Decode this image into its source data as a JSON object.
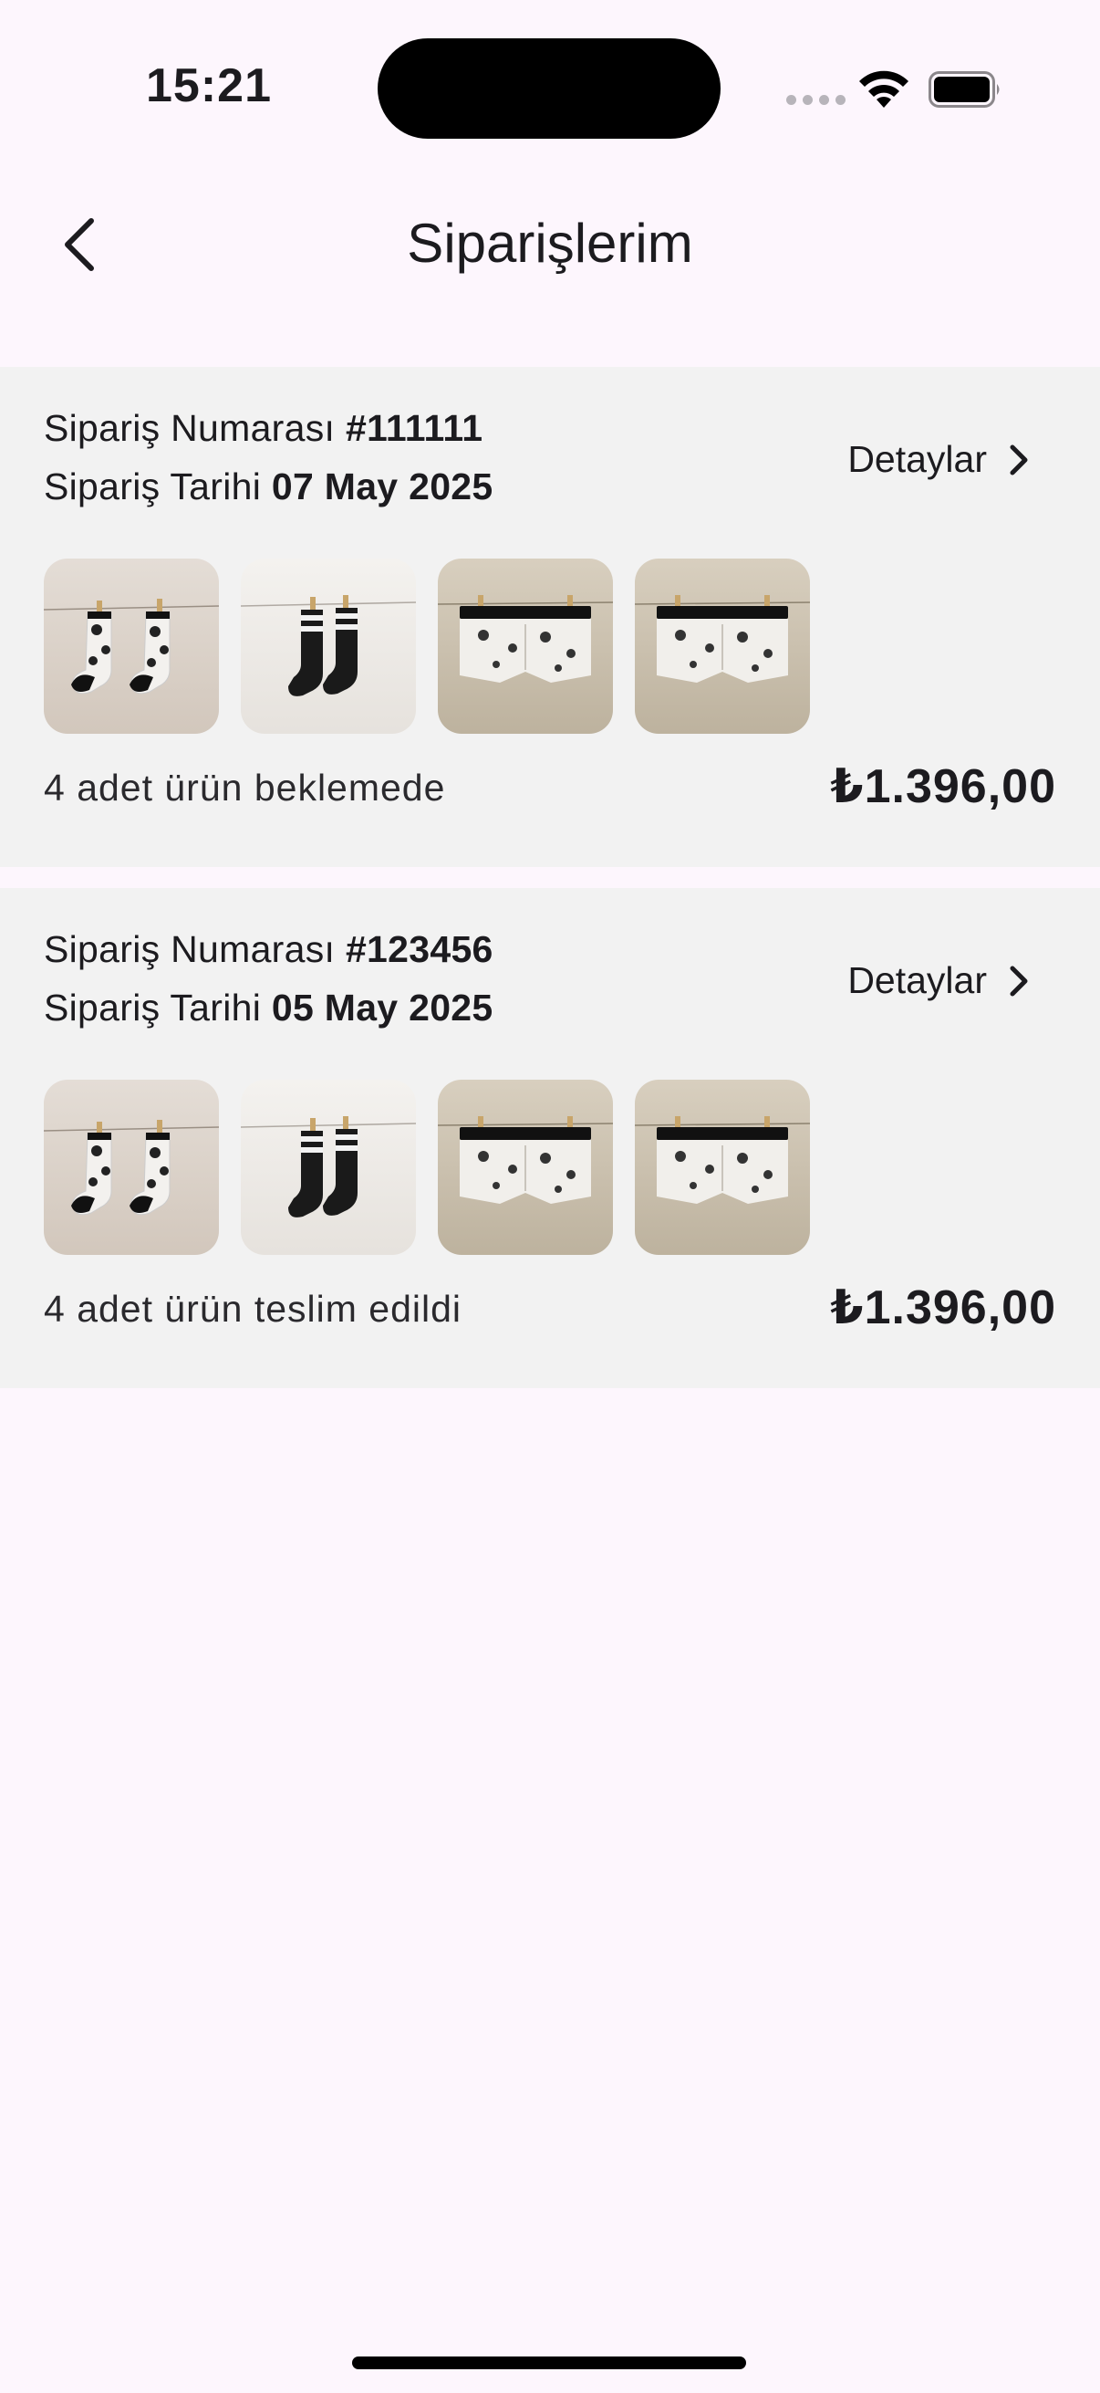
{
  "status_bar": {
    "time": "15:21"
  },
  "header": {
    "title": "Siparişlerim",
    "back_icon": "chevron-left-icon"
  },
  "orders": [
    {
      "number_label": "Sipariş Numarası",
      "number": "#111111",
      "date_label": "Sipariş Tarihi",
      "date": "07 May 2025",
      "details_label": "Detaylar",
      "status": "4 adet ürün beklemede",
      "price": "₺1.396,00",
      "products": [
        "patterned-socks",
        "black-striped-socks",
        "patterned-boxer",
        "patterned-boxer"
      ]
    },
    {
      "number_label": "Sipariş Numarası",
      "number": "#123456",
      "date_label": "Sipariş Tarihi",
      "date": "05 May 2025",
      "details_label": "Detaylar",
      "status": "4 adet ürün teslim edildi",
      "price": "₺1.396,00",
      "products": [
        "patterned-socks",
        "black-striped-socks",
        "patterned-boxer",
        "patterned-boxer"
      ]
    }
  ],
  "colors": {
    "background": "#fdf6fd",
    "card": "#f2f2f2",
    "text": "#1c1b1f"
  }
}
